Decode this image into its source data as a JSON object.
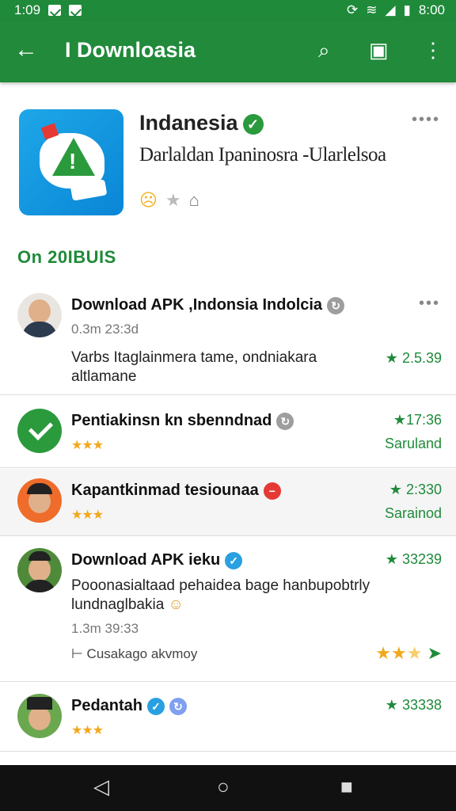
{
  "status": {
    "time": "1:09",
    "clock": "8:00"
  },
  "appbar": {
    "title": "I Downloasia"
  },
  "hero": {
    "title": "Indanesia",
    "subtitle": "Darlaldan Ipaninosra -Ularlelsoa"
  },
  "section": {
    "label": "On 20IBUIS"
  },
  "items": [
    {
      "name": "Download APK ,Indonsia Indolcia",
      "meta": "0.3m 23:3d",
      "body1": "Varbs Itaglainmera tame, ondniakara",
      "body2": "altlamane",
      "rating": "2.5.39"
    },
    {
      "name": "Pentiakinsn kn sbenndnad",
      "rating": "17:36",
      "rsub": "Saruland"
    },
    {
      "name": "Kapantkinmad tesiounaa",
      "rating": "2:330",
      "rsub": "Sarainod"
    },
    {
      "name": "Download APK ieku",
      "body1": "Pooonasialtaad pehaidea bage hanbupobtrly",
      "body2": "lundnaglbakia",
      "meta": "1.3m 39:33",
      "comment": "Cusakago akvmoy",
      "rating": "33239"
    },
    {
      "name": "Pedantah",
      "rating": "33338"
    }
  ],
  "colors": {
    "brand_green": "#218a3b",
    "accent_star": "#f2a81d"
  },
  "icons": {
    "back": "arrow-left-icon",
    "search": "search-icon",
    "share": "image-edit-icon",
    "menu": "more-vert-icon"
  }
}
